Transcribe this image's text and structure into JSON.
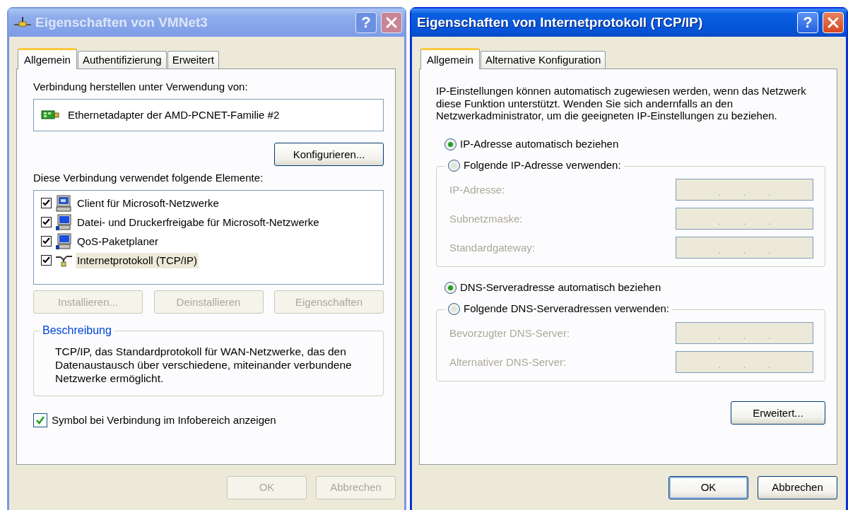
{
  "windows": [
    {
      "kind": "connection",
      "title": "Eigenschaften von VMNet3",
      "active": false,
      "help_button": "?",
      "tabs": [
        {
          "label": "Allgemein",
          "selected": true
        },
        {
          "label": "Authentifizierung",
          "selected": false
        },
        {
          "label": "Erweitert",
          "selected": false
        }
      ],
      "adapter_label": "Verbindung herstellen unter Verwendung von:",
      "adapter": "Ethernetadapter der AMD-PCNET-Familie #2",
      "configure_button": "Konfigurieren...",
      "components_label": "Diese Verbindung verwendet folgende Elemente:",
      "components": [
        {
          "kind": "client",
          "label": "Client für Microsoft-Netzwerke",
          "checked": true,
          "selected": false
        },
        {
          "kind": "service",
          "label": "Datei- und Druckerfreigabe für Microsoft-Netzwerke",
          "checked": true,
          "selected": false
        },
        {
          "kind": "service",
          "label": "QoS-Paketplaner",
          "checked": true,
          "selected": false
        },
        {
          "kind": "protocol",
          "label": "Internetprotokoll (TCP/IP)",
          "checked": true,
          "selected": true
        }
      ],
      "component_buttons": [
        {
          "label": "Installieren...",
          "disabled": true
        },
        {
          "label": "Deinstallieren",
          "disabled": true
        },
        {
          "label": "Eigenschaften",
          "disabled": true
        }
      ],
      "description": {
        "title": "Beschreibung",
        "text": "TCP/IP, das Standardprotokoll für WAN-Netzwerke, das den Datenaustausch über verschiedene, miteinander verbundene Netzwerke ermöglicht."
      },
      "notify_option": {
        "label": "Symbol bei Verbindung im Infobereich anzeigen",
        "checked": true
      },
      "buttons": [
        {
          "label": "OK",
          "disabled": true,
          "default": false
        },
        {
          "label": "Abbrechen",
          "disabled": true,
          "default": false
        }
      ]
    },
    {
      "kind": "protocol",
      "title": "Eigenschaften von Internetprotokoll (TCP/IP)",
      "active": true,
      "help_button": "?",
      "tabs": [
        {
          "label": "Allgemein",
          "selected": true
        },
        {
          "label": "Alternative Konfiguration",
          "selected": false
        }
      ],
      "intro": "IP-Einstellungen können automatisch zugewiesen werden, wenn das Netzwerk diese Funktion unterstützt. Wenden Sie sich andernfalls an den Netzwerkadministrator, um die geeigneten IP-Einstellungen zu beziehen.",
      "ip_options": [
        {
          "label": "IP-Adresse automatisch beziehen",
          "selected": true
        },
        {
          "label": "Folgende IP-Adresse verwenden:",
          "selected": false
        }
      ],
      "ip_fields": [
        {
          "label": "IP-Adresse:",
          "value": ". . .",
          "disabled": true
        },
        {
          "label": "Subnetzmaske:",
          "value": ". . .",
          "disabled": true
        },
        {
          "label": "Standardgateway:",
          "value": ". . .",
          "disabled": true
        }
      ],
      "dns_options": [
        {
          "label": "DNS-Serveradresse automatisch beziehen",
          "selected": true
        },
        {
          "label": "Folgende DNS-Serveradressen verwenden:",
          "selected": false
        }
      ],
      "dns_fields": [
        {
          "label": "Bevorzugter DNS-Server:",
          "value": ". . .",
          "disabled": true
        },
        {
          "label": "Alternativer DNS-Server:",
          "value": ". . .",
          "disabled": true
        }
      ],
      "advanced_button": "Erweitert...",
      "buttons": [
        {
          "label": "OK",
          "disabled": false,
          "default": true
        },
        {
          "label": "Abbrechen",
          "disabled": false,
          "default": false
        }
      ]
    }
  ]
}
